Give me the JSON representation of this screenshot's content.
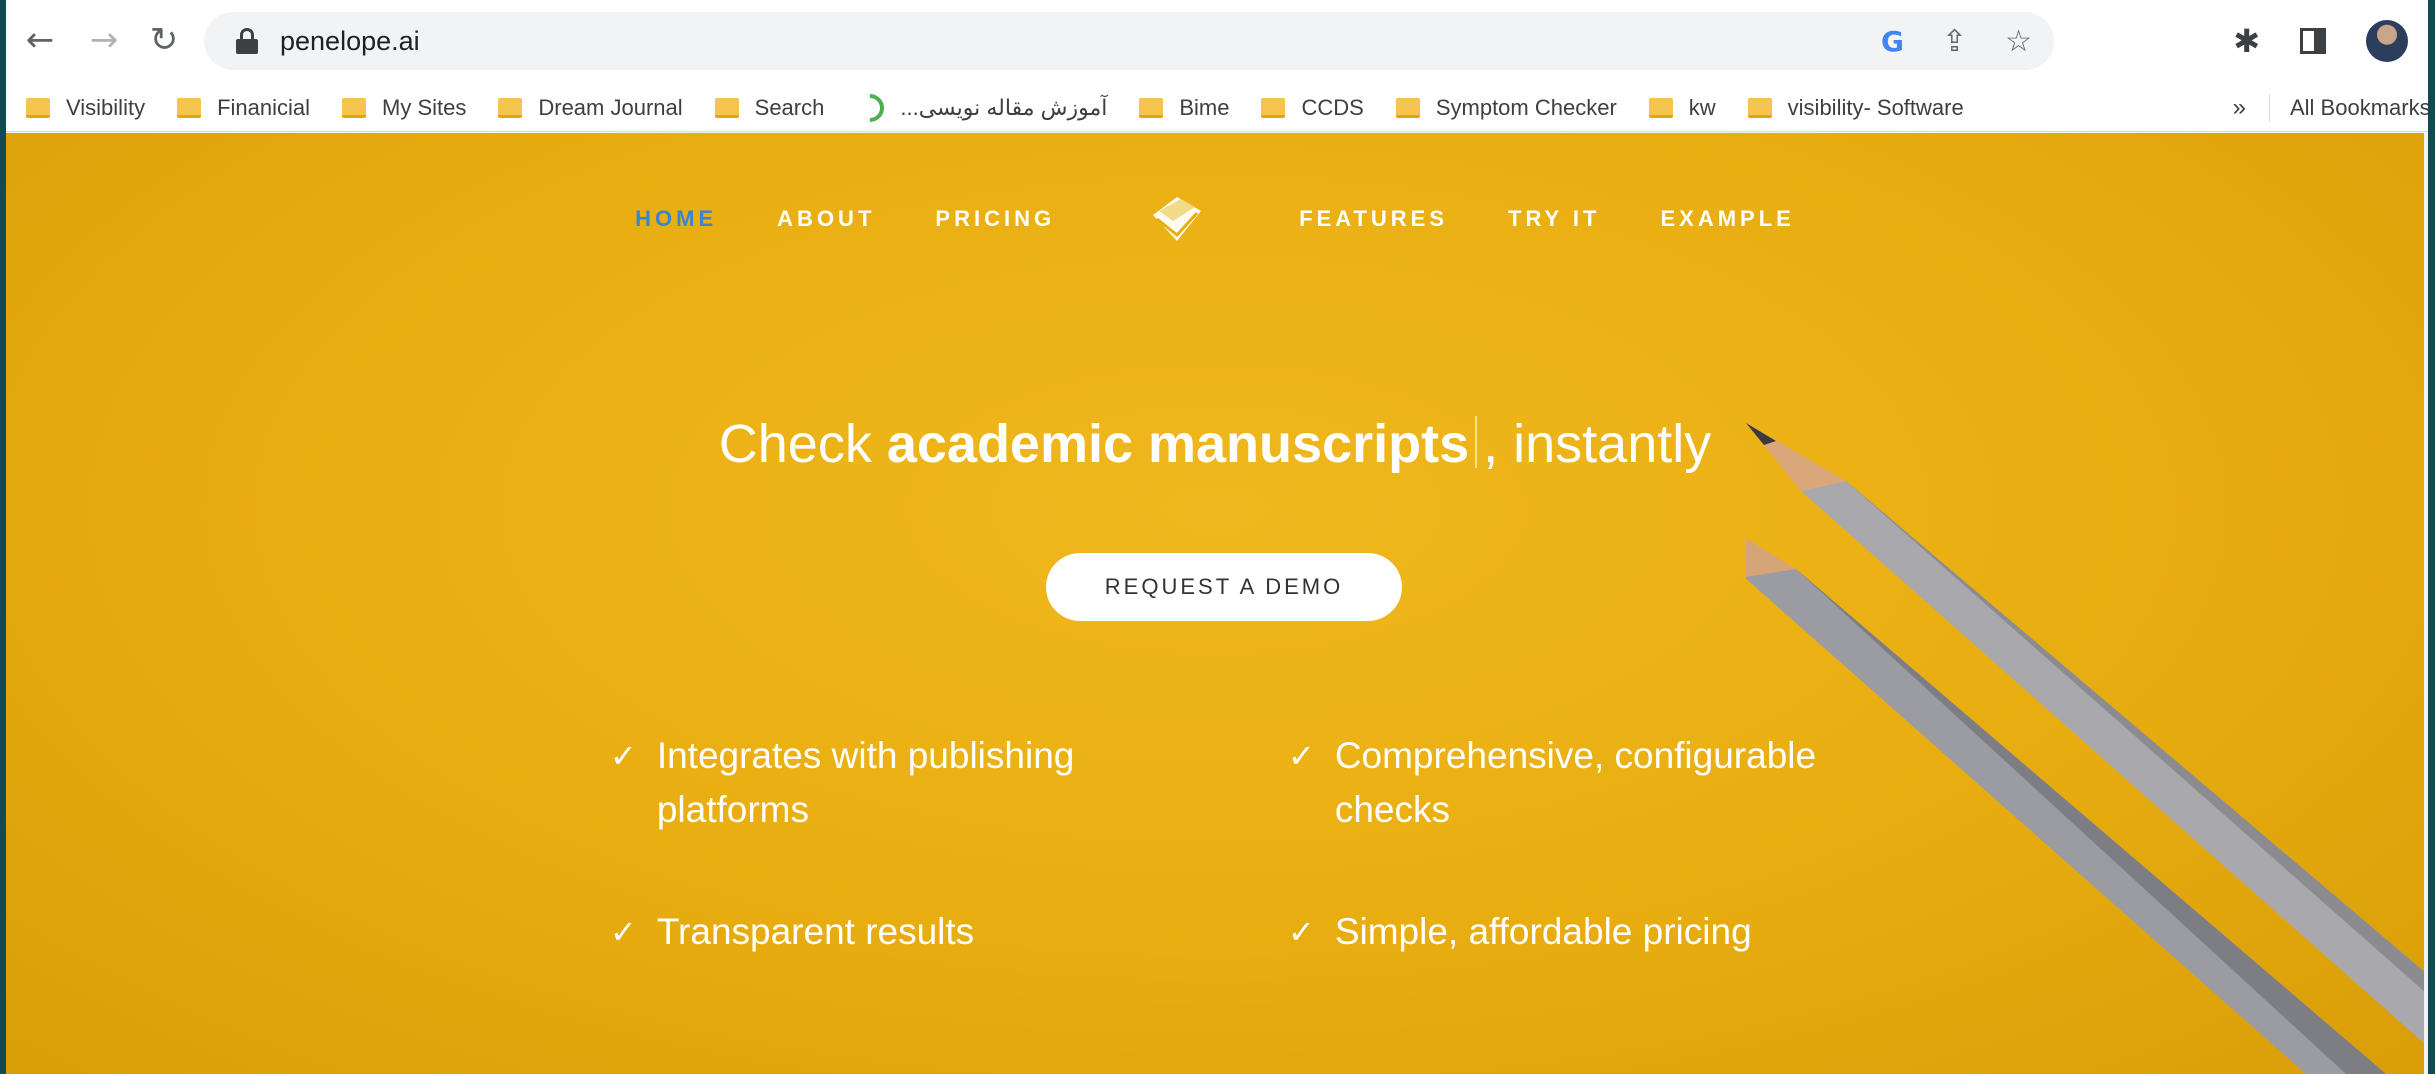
{
  "browser": {
    "url": "penelope.ai",
    "bookmarks": [
      {
        "label": "Visibility",
        "icon": "folder-icon"
      },
      {
        "label": "Finanicial",
        "icon": "folder-icon"
      },
      {
        "label": "My Sites",
        "icon": "folder-icon"
      },
      {
        "label": "Dream Journal",
        "icon": "folder-icon"
      },
      {
        "label": "Search",
        "icon": "folder-icon"
      },
      {
        "label": "آموزش مقاله نویسی...",
        "icon": "feed-icon"
      },
      {
        "label": "Bime",
        "icon": "folder-icon"
      },
      {
        "label": "CCDS",
        "icon": "folder-icon"
      },
      {
        "label": "Symptom Checker",
        "icon": "folder-icon"
      },
      {
        "label": "kw",
        "icon": "folder-icon"
      },
      {
        "label": "visibility- Software",
        "icon": "folder-icon"
      }
    ],
    "more_bookmarks": "»",
    "all_bookmarks": "All Bookmarks"
  },
  "site": {
    "nav": {
      "home": "HOME",
      "about": "ABOUT",
      "pricing": "PRICING",
      "features": "FEATURES",
      "try_it": "TRY IT",
      "example": "EXAMPLE"
    },
    "hero": {
      "title_lead": "Check ",
      "title_bold": "academic manuscripts",
      "title_tail": ", instantly",
      "cta": "REQUEST A DEMO"
    },
    "features": [
      {
        "line1": "Integrates with publishing",
        "line2": "platforms"
      },
      {
        "line1": "Comprehensive, configurable",
        "line2": "checks"
      },
      {
        "line1": "Transparent results",
        "line2": ""
      },
      {
        "line1": "Simple, affordable pricing",
        "line2": ""
      }
    ],
    "check_glyph": "✓"
  },
  "colors": {
    "hero_bg": "#e8ad10",
    "nav_active": "#3a86c8",
    "text_on_hero": "#ffffff"
  }
}
